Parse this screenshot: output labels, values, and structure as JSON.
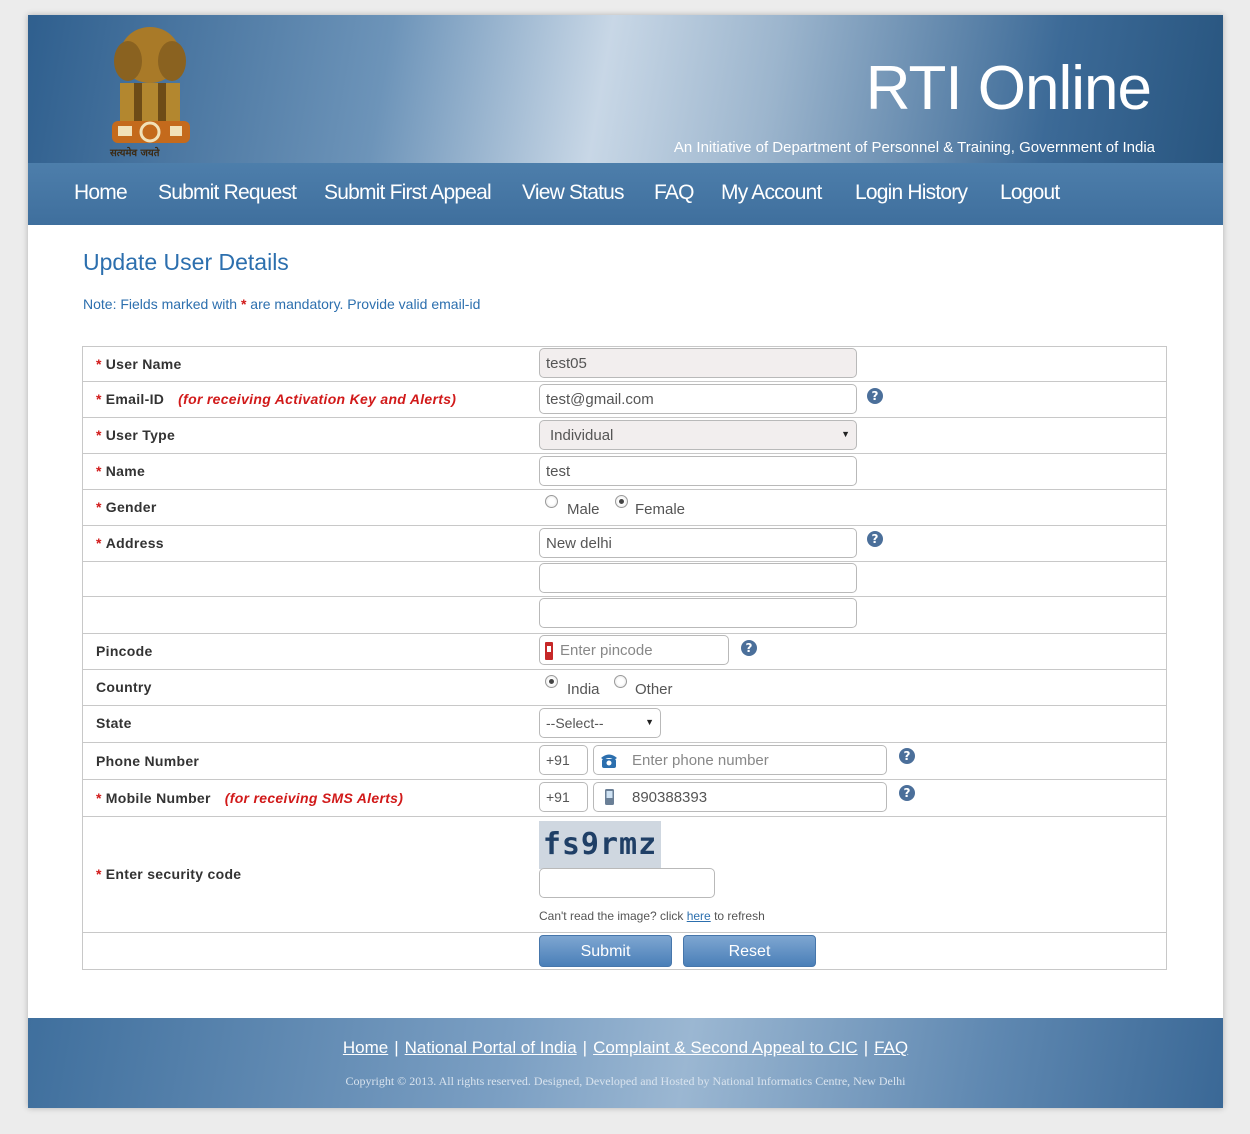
{
  "header": {
    "title": "RTI Online",
    "tagline": "An Initiative of Department of Personnel & Training, Government of India",
    "emblem_motto": "सत्यमेव जयते"
  },
  "nav": {
    "items": [
      "Home",
      "Submit Request",
      "Submit First Appeal",
      "View Status",
      "FAQ",
      "My Account",
      "Login History",
      "Logout"
    ]
  },
  "page": {
    "title": "Update User Details",
    "note_prefix": "Note: Fields marked with ",
    "note_star": "*",
    "note_suffix": " are mandatory. Provide valid email-id"
  },
  "form": {
    "required_mark": "*",
    "user_name": {
      "label": "User Name",
      "value": "test05"
    },
    "email": {
      "label": "Email-ID",
      "hint": "(for receiving Activation Key and Alerts)",
      "value": "test@gmail.com"
    },
    "user_type": {
      "label": "User Type",
      "value": "Individual"
    },
    "name": {
      "label": "Name",
      "value": "test"
    },
    "gender": {
      "label": "Gender",
      "options": [
        "Male",
        "Female"
      ],
      "selected": "Female"
    },
    "address": {
      "label": "Address",
      "line1": "New delhi",
      "line2": "",
      "line3": ""
    },
    "pincode": {
      "label": "Pincode",
      "placeholder": "Enter pincode"
    },
    "country": {
      "label": "Country",
      "options": [
        "India",
        "Other"
      ],
      "selected": "India"
    },
    "state": {
      "label": "State",
      "value": "--Select--"
    },
    "phone": {
      "label": "Phone Number",
      "code": "+91",
      "placeholder": "Enter phone number"
    },
    "mobile": {
      "label": "Mobile Number",
      "hint": "(for receiving SMS Alerts)",
      "code": "+91",
      "value": "890388393"
    },
    "security": {
      "label": "Enter security code",
      "captcha": "fs9rmz",
      "refresh_prefix": "Can't read the image? click ",
      "refresh_link": "here",
      "refresh_suffix": " to refresh"
    },
    "submit_label": "Submit",
    "reset_label": "Reset"
  },
  "footer": {
    "links": [
      "Home",
      "National Portal of India",
      "Complaint & Second Appeal to CIC",
      "FAQ"
    ],
    "separator": "|",
    "copyright": "Copyright © 2013. All rights reserved. Designed, Developed and Hosted by National Informatics Centre, New Delhi"
  },
  "icons": {
    "help": "question-circle-icon",
    "pincode": "pin-icon",
    "phone": "telephone-icon",
    "mobile": "mobile-phone-icon"
  },
  "colors": {
    "accent": "#2c6fae",
    "required": "#d11a1a",
    "nav": "#4677a6"
  }
}
